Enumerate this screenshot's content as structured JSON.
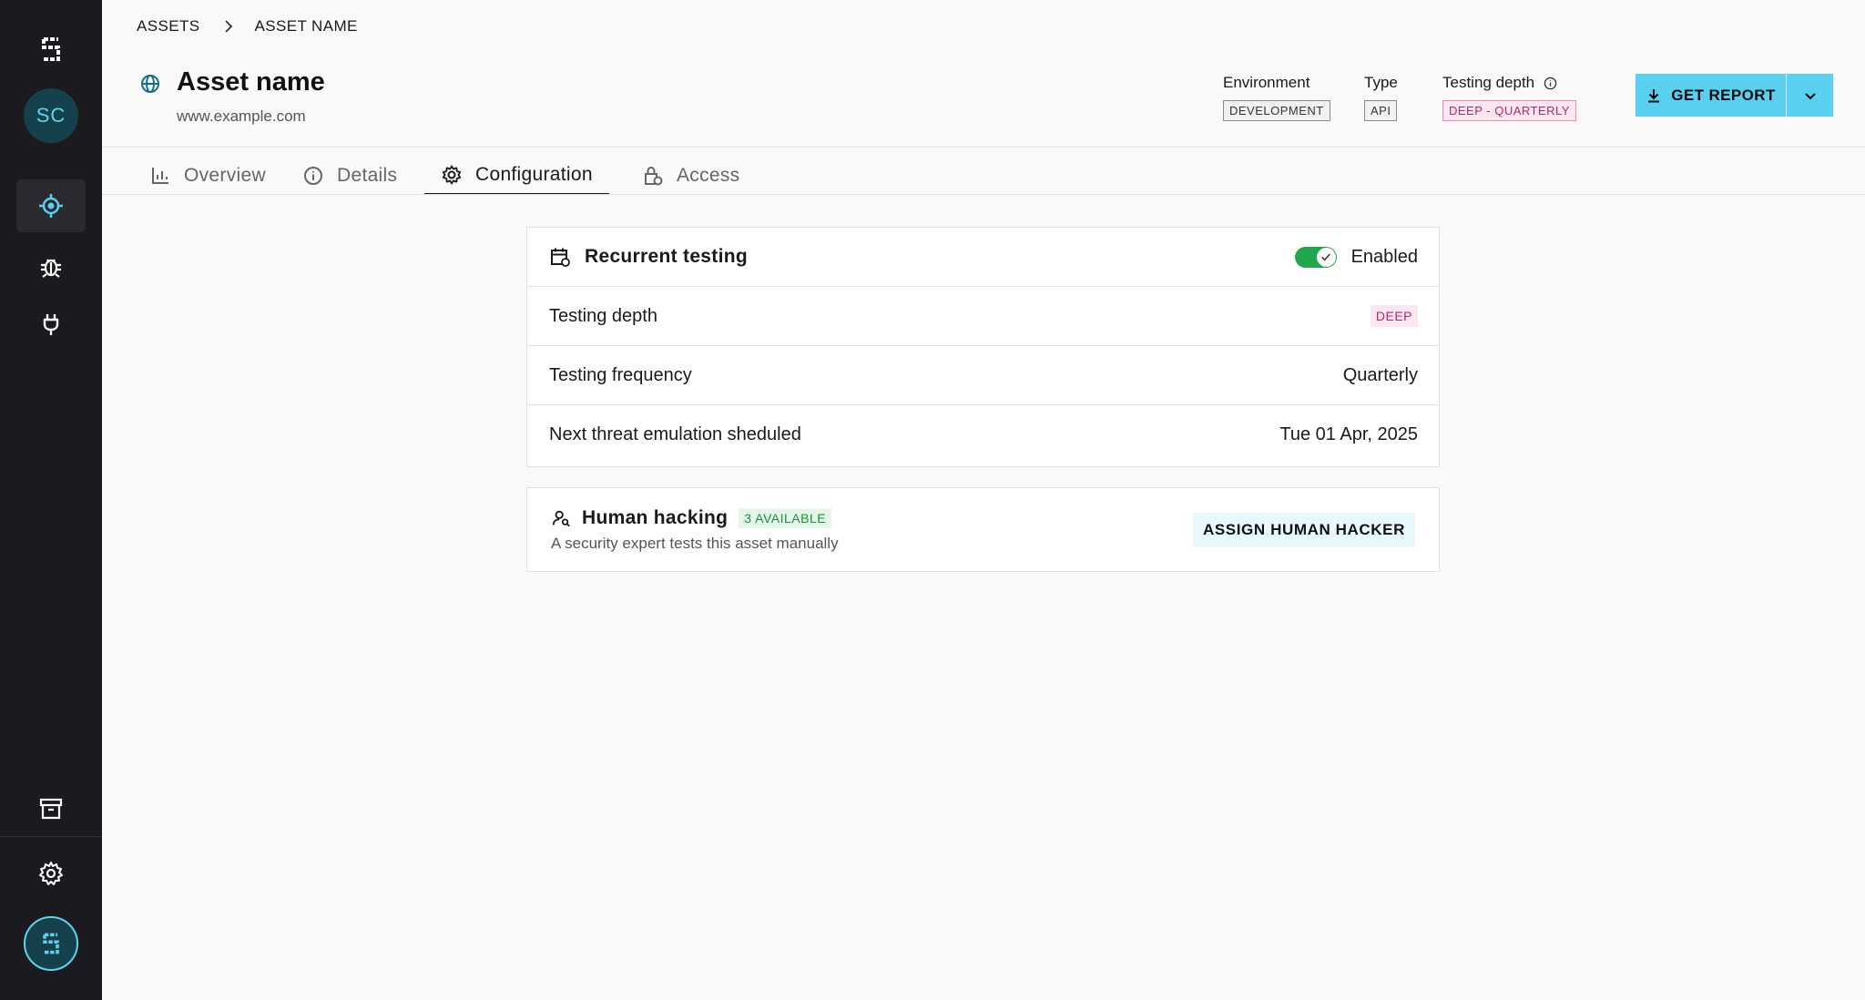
{
  "breadcrumb": {
    "root": "ASSETS",
    "current": "ASSET NAME"
  },
  "sidebar": {
    "avatar_initials": "SC"
  },
  "asset": {
    "title": "Asset name",
    "url": "www.example.com"
  },
  "meta": {
    "environment": {
      "label": "Environment",
      "value": "DEVELOPMENT"
    },
    "type": {
      "label": "Type",
      "value": "API"
    },
    "testing_depth": {
      "label": "Testing depth",
      "value": "DEEP - QUARTERLY"
    }
  },
  "actions": {
    "get_report": "GET REPORT"
  },
  "tabs": [
    {
      "label": "Overview"
    },
    {
      "label": "Details"
    },
    {
      "label": "Configuration"
    },
    {
      "label": "Access"
    }
  ],
  "recurrent": {
    "title": "Recurrent testing",
    "toggle_label": "Enabled",
    "rows": [
      {
        "label": "Testing depth",
        "value": "DEEP"
      },
      {
        "label": "Testing frequency",
        "value": "Quarterly"
      },
      {
        "label": "Next threat emulation sheduled",
        "value": "Tue 01 Apr, 2025"
      }
    ]
  },
  "human_hacking": {
    "title": "Human hacking",
    "badge": "3 AVAILABLE",
    "subtitle": "A security expert tests this asset manually",
    "button": "ASSIGN HUMAN HACKER"
  },
  "colors": {
    "accent": "#5ad0f0",
    "sidebar": "#1b1b1f",
    "toggle_on": "#22a84c",
    "pink": "#b0286b",
    "green": "#1f8c3e"
  }
}
